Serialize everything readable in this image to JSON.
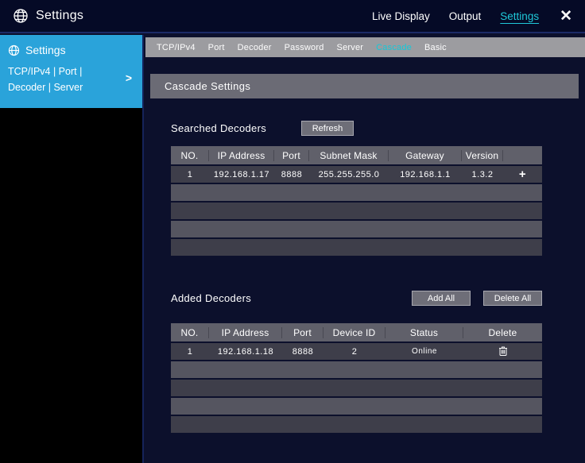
{
  "colors": {
    "accent_cyan": "#1fc8d8",
    "sidebar_blue": "#2aa3da",
    "titlebar_bg": "#050a26",
    "main_bg": "#0c102c",
    "bar_gray": "#6b6b75",
    "table_header_gray": "#60606a"
  },
  "header": {
    "title": "Settings",
    "nav": [
      {
        "label": "Live Display",
        "active": false
      },
      {
        "label": "Output",
        "active": false
      },
      {
        "label": "Settings",
        "active": true
      }
    ],
    "close_glyph": "✕"
  },
  "sidebar": {
    "title": "Settings",
    "subtitle": "TCP/IPv4 | Port | Decoder | Server",
    "chevron_glyph": ">"
  },
  "tabs": [
    {
      "label": "TCP/IPv4",
      "active": false
    },
    {
      "label": "Port",
      "active": false
    },
    {
      "label": "Decoder",
      "active": false
    },
    {
      "label": "Password",
      "active": false
    },
    {
      "label": "Server",
      "active": false
    },
    {
      "label": "Cascade",
      "active": true
    },
    {
      "label": "Basic",
      "active": false
    }
  ],
  "section_title": "Cascade Settings",
  "searched": {
    "label": "Searched Decoders",
    "refresh_label": "Refresh",
    "table": {
      "headers": [
        "NO.",
        "IP Address",
        "Port",
        "Subnet Mask",
        "Gateway",
        "Version",
        ""
      ],
      "rows": [
        [
          "1",
          "192.168.1.17",
          "8888",
          "255.255.255.0",
          "192.168.1.1",
          "1.3.2",
          "+"
        ]
      ],
      "empty_row_count": 4
    }
  },
  "added": {
    "label": "Added Decoders",
    "add_all_label": "Add All",
    "delete_all_label": "Delete All",
    "table": {
      "headers": [
        "NO.",
        "IP Address",
        "Port",
        "Device ID",
        "Status",
        "Delete"
      ],
      "rows": [
        [
          "1",
          "192.168.1.18",
          "8888",
          "2",
          "Online"
        ]
      ],
      "empty_row_count": 4
    }
  }
}
